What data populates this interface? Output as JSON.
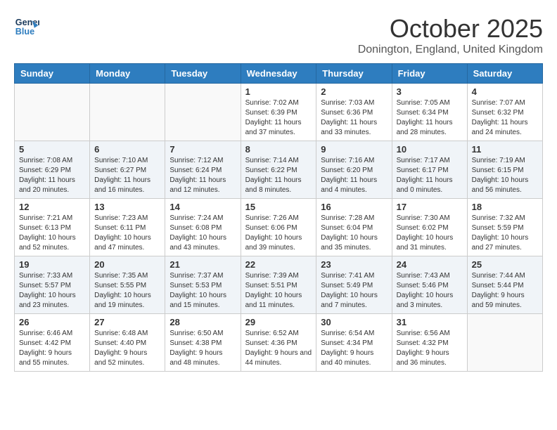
{
  "header": {
    "logo_general": "General",
    "logo_blue": "Blue",
    "month": "October 2025",
    "location": "Donington, England, United Kingdom"
  },
  "weekdays": [
    "Sunday",
    "Monday",
    "Tuesday",
    "Wednesday",
    "Thursday",
    "Friday",
    "Saturday"
  ],
  "weeks": [
    [
      {
        "day": "",
        "info": ""
      },
      {
        "day": "",
        "info": ""
      },
      {
        "day": "",
        "info": ""
      },
      {
        "day": "1",
        "info": "Sunrise: 7:02 AM\nSunset: 6:39 PM\nDaylight: 11 hours and 37 minutes."
      },
      {
        "day": "2",
        "info": "Sunrise: 7:03 AM\nSunset: 6:36 PM\nDaylight: 11 hours and 33 minutes."
      },
      {
        "day": "3",
        "info": "Sunrise: 7:05 AM\nSunset: 6:34 PM\nDaylight: 11 hours and 28 minutes."
      },
      {
        "day": "4",
        "info": "Sunrise: 7:07 AM\nSunset: 6:32 PM\nDaylight: 11 hours and 24 minutes."
      }
    ],
    [
      {
        "day": "5",
        "info": "Sunrise: 7:08 AM\nSunset: 6:29 PM\nDaylight: 11 hours and 20 minutes."
      },
      {
        "day": "6",
        "info": "Sunrise: 7:10 AM\nSunset: 6:27 PM\nDaylight: 11 hours and 16 minutes."
      },
      {
        "day": "7",
        "info": "Sunrise: 7:12 AM\nSunset: 6:24 PM\nDaylight: 11 hours and 12 minutes."
      },
      {
        "day": "8",
        "info": "Sunrise: 7:14 AM\nSunset: 6:22 PM\nDaylight: 11 hours and 8 minutes."
      },
      {
        "day": "9",
        "info": "Sunrise: 7:16 AM\nSunset: 6:20 PM\nDaylight: 11 hours and 4 minutes."
      },
      {
        "day": "10",
        "info": "Sunrise: 7:17 AM\nSunset: 6:17 PM\nDaylight: 11 hours and 0 minutes."
      },
      {
        "day": "11",
        "info": "Sunrise: 7:19 AM\nSunset: 6:15 PM\nDaylight: 10 hours and 56 minutes."
      }
    ],
    [
      {
        "day": "12",
        "info": "Sunrise: 7:21 AM\nSunset: 6:13 PM\nDaylight: 10 hours and 52 minutes."
      },
      {
        "day": "13",
        "info": "Sunrise: 7:23 AM\nSunset: 6:11 PM\nDaylight: 10 hours and 47 minutes."
      },
      {
        "day": "14",
        "info": "Sunrise: 7:24 AM\nSunset: 6:08 PM\nDaylight: 10 hours and 43 minutes."
      },
      {
        "day": "15",
        "info": "Sunrise: 7:26 AM\nSunset: 6:06 PM\nDaylight: 10 hours and 39 minutes."
      },
      {
        "day": "16",
        "info": "Sunrise: 7:28 AM\nSunset: 6:04 PM\nDaylight: 10 hours and 35 minutes."
      },
      {
        "day": "17",
        "info": "Sunrise: 7:30 AM\nSunset: 6:02 PM\nDaylight: 10 hours and 31 minutes."
      },
      {
        "day": "18",
        "info": "Sunrise: 7:32 AM\nSunset: 5:59 PM\nDaylight: 10 hours and 27 minutes."
      }
    ],
    [
      {
        "day": "19",
        "info": "Sunrise: 7:33 AM\nSunset: 5:57 PM\nDaylight: 10 hours and 23 minutes."
      },
      {
        "day": "20",
        "info": "Sunrise: 7:35 AM\nSunset: 5:55 PM\nDaylight: 10 hours and 19 minutes."
      },
      {
        "day": "21",
        "info": "Sunrise: 7:37 AM\nSunset: 5:53 PM\nDaylight: 10 hours and 15 minutes."
      },
      {
        "day": "22",
        "info": "Sunrise: 7:39 AM\nSunset: 5:51 PM\nDaylight: 10 hours and 11 minutes."
      },
      {
        "day": "23",
        "info": "Sunrise: 7:41 AM\nSunset: 5:49 PM\nDaylight: 10 hours and 7 minutes."
      },
      {
        "day": "24",
        "info": "Sunrise: 7:43 AM\nSunset: 5:46 PM\nDaylight: 10 hours and 3 minutes."
      },
      {
        "day": "25",
        "info": "Sunrise: 7:44 AM\nSunset: 5:44 PM\nDaylight: 9 hours and 59 minutes."
      }
    ],
    [
      {
        "day": "26",
        "info": "Sunrise: 6:46 AM\nSunset: 4:42 PM\nDaylight: 9 hours and 55 minutes."
      },
      {
        "day": "27",
        "info": "Sunrise: 6:48 AM\nSunset: 4:40 PM\nDaylight: 9 hours and 52 minutes."
      },
      {
        "day": "28",
        "info": "Sunrise: 6:50 AM\nSunset: 4:38 PM\nDaylight: 9 hours and 48 minutes."
      },
      {
        "day": "29",
        "info": "Sunrise: 6:52 AM\nSunset: 4:36 PM\nDaylight: 9 hours and 44 minutes."
      },
      {
        "day": "30",
        "info": "Sunrise: 6:54 AM\nSunset: 4:34 PM\nDaylight: 9 hours and 40 minutes."
      },
      {
        "day": "31",
        "info": "Sunrise: 6:56 AM\nSunset: 4:32 PM\nDaylight: 9 hours and 36 minutes."
      },
      {
        "day": "",
        "info": ""
      }
    ]
  ]
}
